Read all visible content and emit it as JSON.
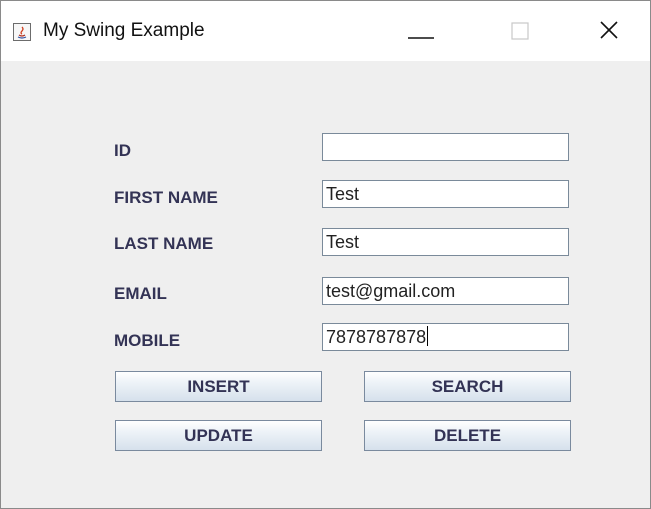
{
  "window": {
    "title": "My Swing Example"
  },
  "icons": {
    "app": "java-app-icon",
    "minimize": "minimize-icon",
    "maximize": "maximize-icon",
    "close": "close-icon"
  },
  "form": {
    "fields": [
      {
        "label": "ID",
        "value": ""
      },
      {
        "label": "FIRST NAME",
        "value": "Test"
      },
      {
        "label": "LAST NAME",
        "value": "Test"
      },
      {
        "label": "EMAIL",
        "value": "test@gmail.com"
      },
      {
        "label": "MOBILE",
        "value": "7878787878"
      }
    ]
  },
  "buttons": {
    "insert": "INSERT",
    "search": "SEARCH",
    "update": "UPDATE",
    "delete": "DELETE"
  },
  "colors": {
    "label_text": "#333355",
    "button_border": "#7a8a9e",
    "window_background": "#efefef"
  }
}
